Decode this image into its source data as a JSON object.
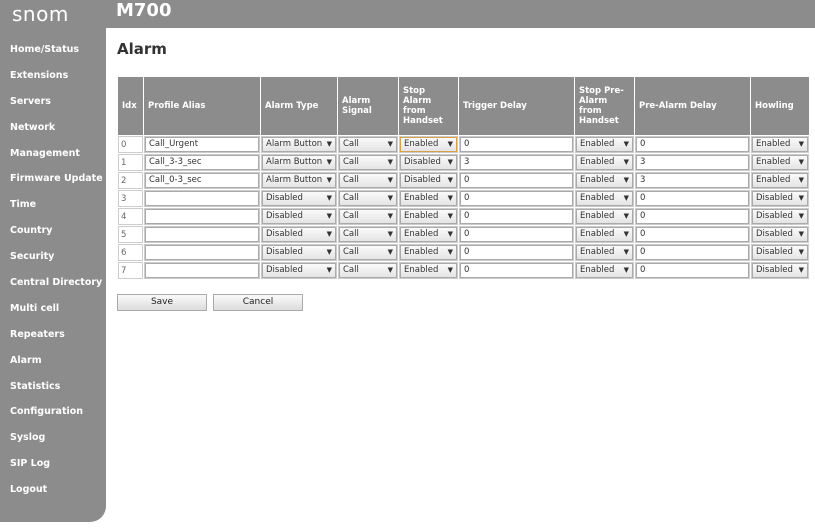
{
  "brand": {
    "logo": "snom",
    "model": "M700"
  },
  "sidebar": {
    "items": [
      "Home/Status",
      "Extensions",
      "Servers",
      "Network",
      "Management",
      "Firmware Update",
      "Time",
      "Country",
      "Security",
      "Central Directory",
      "Multi cell",
      "Repeaters",
      "Alarm",
      "Statistics",
      "Configuration",
      "Syslog",
      "SIP Log",
      "Logout"
    ]
  },
  "page": {
    "title": "Alarm"
  },
  "table": {
    "headers": {
      "idx": "Idx",
      "alias": "Profile Alias",
      "type": "Alarm Type",
      "signal": "Alarm Signal",
      "stop": "Stop Alarm from Handset",
      "trigger": "Trigger Delay",
      "stop_pre": "Stop Pre-Alarm from Handset",
      "pre_delay": "Pre-Alarm Delay",
      "howling": "Howling"
    },
    "rows": [
      {
        "idx": "0",
        "alias": "Call_Urgent",
        "type": "Alarm Button",
        "signal": "Call",
        "stop": "Enabled",
        "trigger": "0",
        "stop_pre": "Enabled",
        "pre_delay": "0",
        "howling": "Enabled"
      },
      {
        "idx": "1",
        "alias": "Call_3-3_sec",
        "type": "Alarm Button",
        "signal": "Call",
        "stop": "Disabled",
        "trigger": "3",
        "stop_pre": "Enabled",
        "pre_delay": "3",
        "howling": "Enabled"
      },
      {
        "idx": "2",
        "alias": "Call_0-3_sec",
        "type": "Alarm Button",
        "signal": "Call",
        "stop": "Disabled",
        "trigger": "0",
        "stop_pre": "Enabled",
        "pre_delay": "3",
        "howling": "Enabled"
      },
      {
        "idx": "3",
        "alias": "",
        "type": "Disabled",
        "signal": "Call",
        "stop": "Enabled",
        "trigger": "0",
        "stop_pre": "Enabled",
        "pre_delay": "0",
        "howling": "Disabled"
      },
      {
        "idx": "4",
        "alias": "",
        "type": "Disabled",
        "signal": "Call",
        "stop": "Enabled",
        "trigger": "0",
        "stop_pre": "Enabled",
        "pre_delay": "0",
        "howling": "Disabled"
      },
      {
        "idx": "5",
        "alias": "",
        "type": "Disabled",
        "signal": "Call",
        "stop": "Enabled",
        "trigger": "0",
        "stop_pre": "Enabled",
        "pre_delay": "0",
        "howling": "Disabled"
      },
      {
        "idx": "6",
        "alias": "",
        "type": "Disabled",
        "signal": "Call",
        "stop": "Enabled",
        "trigger": "0",
        "stop_pre": "Enabled",
        "pre_delay": "0",
        "howling": "Disabled"
      },
      {
        "idx": "7",
        "alias": "",
        "type": "Disabled",
        "signal": "Call",
        "stop": "Enabled",
        "trigger": "0",
        "stop_pre": "Enabled",
        "pre_delay": "0",
        "howling": "Disabled"
      }
    ]
  },
  "buttons": {
    "save": "Save",
    "cancel": "Cancel"
  },
  "icons": {
    "dropdown": "chevron-down-icon"
  }
}
